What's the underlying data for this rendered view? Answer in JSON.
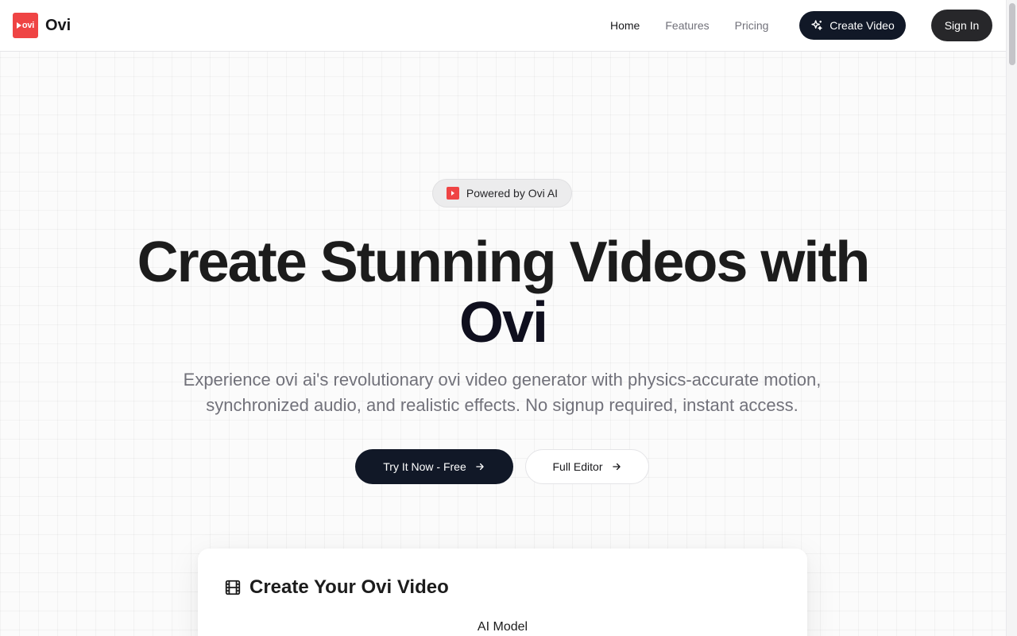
{
  "header": {
    "brand_logo_text": "ovi",
    "brand_name": "Ovi",
    "nav": [
      {
        "label": "Home"
      },
      {
        "label": "Features"
      },
      {
        "label": "Pricing"
      }
    ],
    "create_label": "Create Video",
    "signin_label": "Sign In"
  },
  "hero": {
    "badge": "Powered by Ovi AI",
    "title_line1": "Create Stunning Videos with",
    "title_line2": "Ovi",
    "subtitle": "Experience ovi ai's revolutionary ovi video generator with physics-accurate motion, synchronized audio, and realistic effects. No signup required, instant access.",
    "try_label": "Try It Now - Free",
    "editor_label": "Full Editor"
  },
  "card": {
    "title": "Create Your Ovi Video",
    "model_label": "AI Model"
  },
  "colors": {
    "brand_red": "#ef4444",
    "primary_dark": "#111827"
  },
  "icons": [
    "ovi-logo-icon",
    "sparkles-icon",
    "arrow-right-icon",
    "film-icon"
  ]
}
